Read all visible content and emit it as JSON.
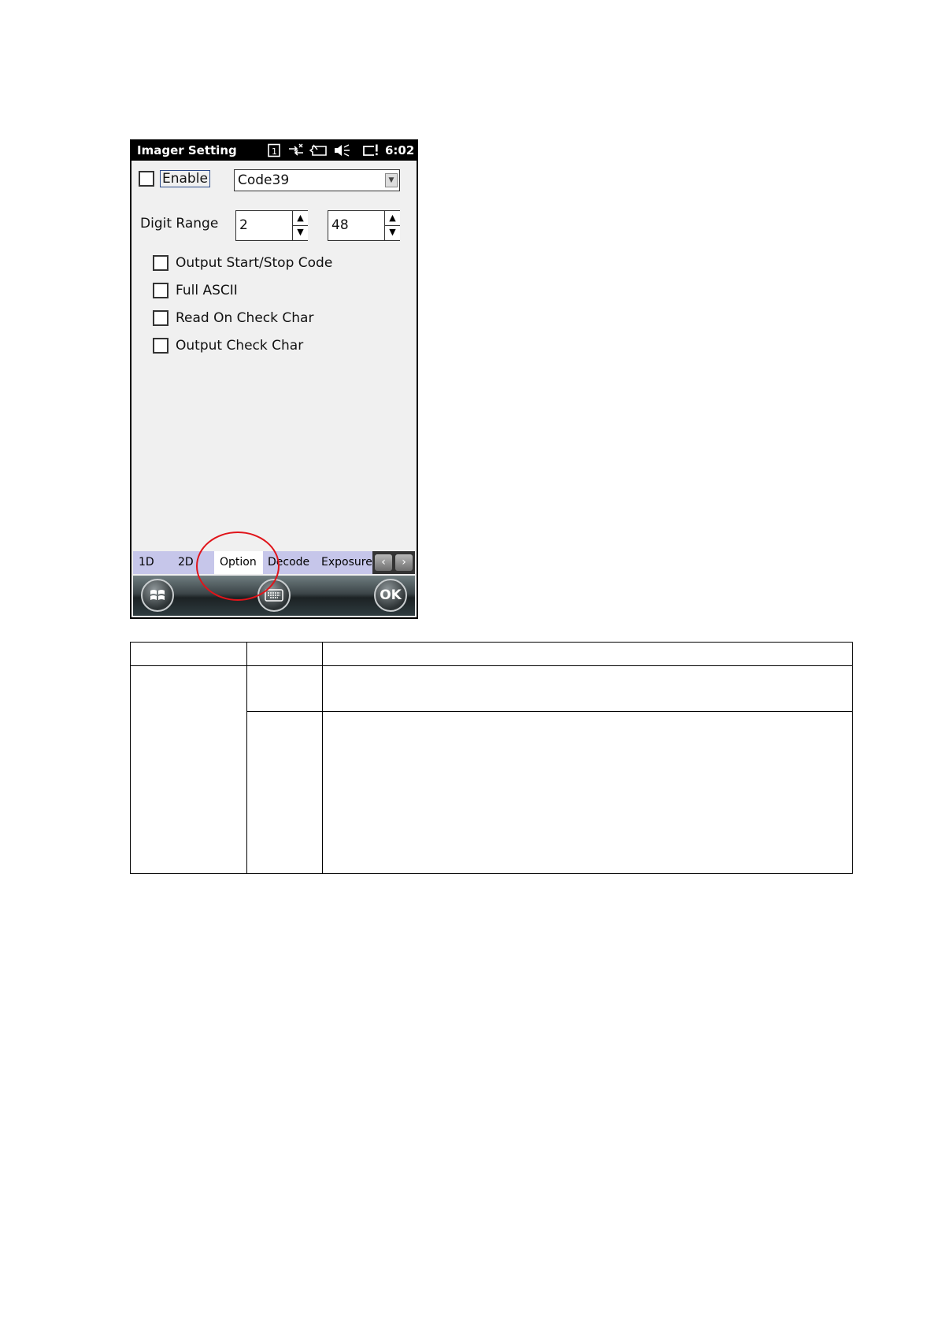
{
  "window": {
    "title": "Imager Setting",
    "time": "6:02",
    "status_icons": [
      "sim-card-icon",
      "connectivity-icon",
      "battery-icon",
      "speaker-muted-icon",
      "notification-icon"
    ]
  },
  "symbology": {
    "enable_label": "Enable",
    "enable_checked": false,
    "selected": "Code39"
  },
  "digit_range": {
    "label": "Digit Range",
    "min": "2",
    "max": "48"
  },
  "options": [
    {
      "label": "Output Start/Stop Code",
      "checked": false
    },
    {
      "label": "Full ASCII",
      "checked": false
    },
    {
      "label": "Read On Check Char",
      "checked": false
    },
    {
      "label": "Output Check Char",
      "checked": false
    }
  ],
  "tabs": [
    {
      "label": "1D"
    },
    {
      "label": "2D"
    },
    {
      "label": "Option",
      "active": true
    },
    {
      "label": "Decode"
    },
    {
      "label": "Exposure"
    }
  ],
  "bottombar": {
    "ok_label": "OK"
  },
  "colors": {
    "annotation": "#e0141a",
    "tab_bar": "#c6c6ea"
  }
}
